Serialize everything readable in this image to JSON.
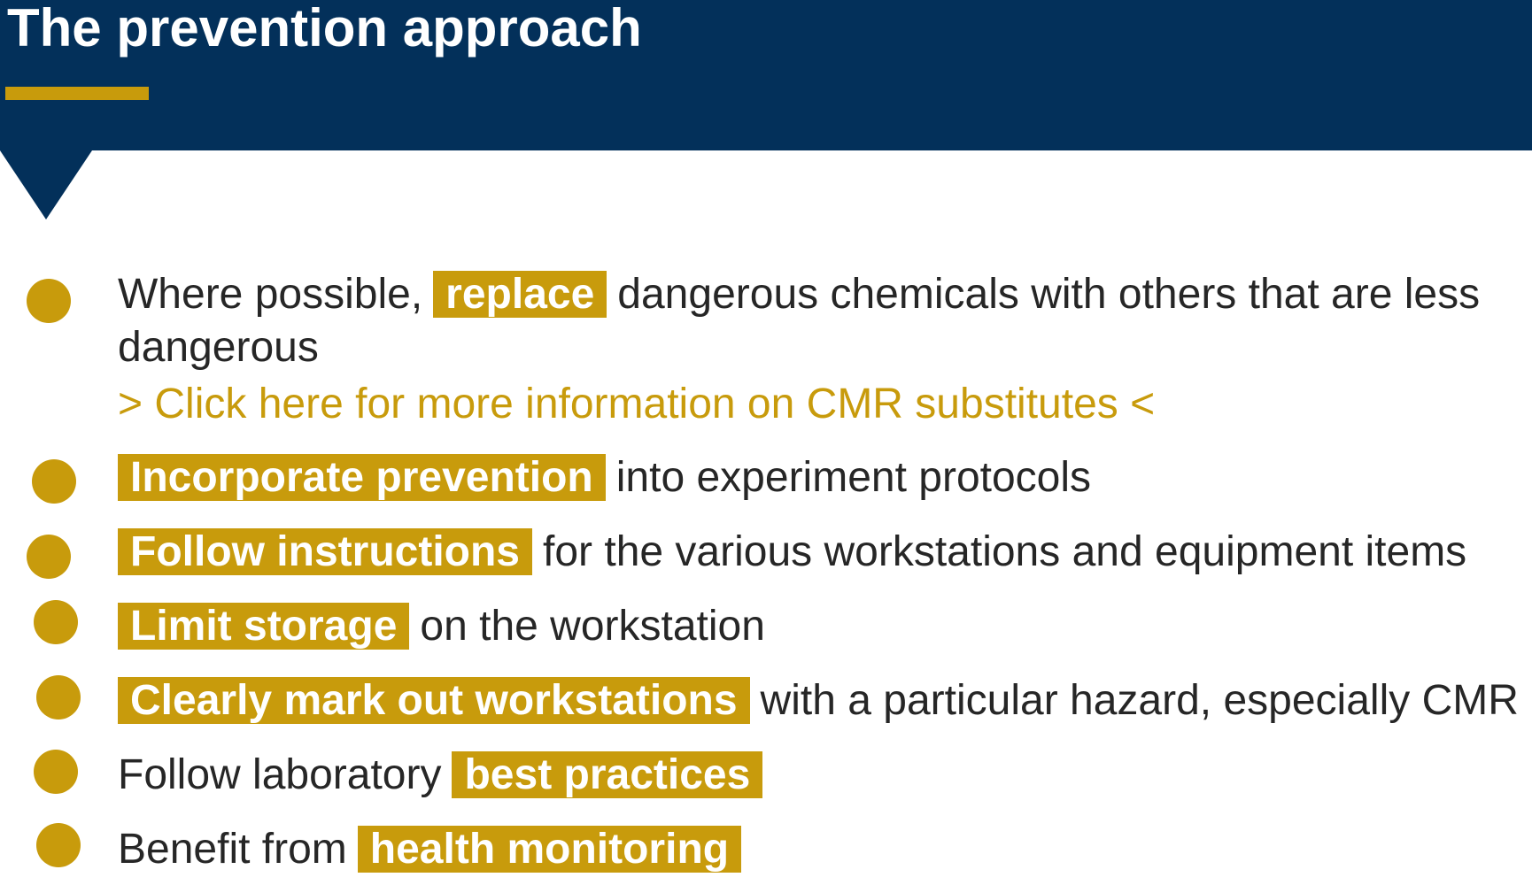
{
  "title": "The prevention approach",
  "colors": {
    "header_bg": "#03305a",
    "accent": "#c89b0c",
    "text": "#262626",
    "highlight_text": "#ffffff"
  },
  "items": [
    {
      "pre": "Where possible,",
      "highlight": "replace",
      "post": "dangerous chemicals with others that are less",
      "post2": "dangerous",
      "link": "> Click here for more information on CMR substitutes <"
    },
    {
      "highlight": "Incorporate prevention",
      "post": "into experiment protocols"
    },
    {
      "highlight": "Follow instructions",
      "post": "for the various workstations and equipment items"
    },
    {
      "highlight": "Limit storage",
      "post": "on the workstation"
    },
    {
      "highlight": "Clearly mark out workstations",
      "post": "with a particular hazard, especially CMR"
    },
    {
      "pre": "Follow laboratory",
      "highlight": "best practices"
    },
    {
      "pre": "Benefit from",
      "highlight": "health monitoring"
    }
  ]
}
